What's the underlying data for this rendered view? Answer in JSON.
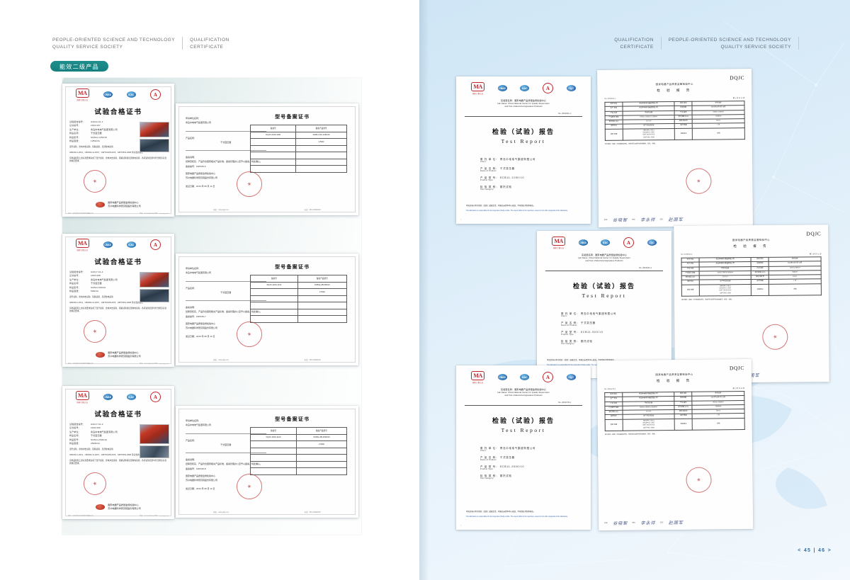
{
  "spread": {
    "page_numbers": "< 45 | 46 >"
  },
  "left_page": {
    "header": {
      "brand_line1": "PEOPLE-ORIENTED SCIENCE AND TECHNOLOGY",
      "brand_line2": "QUALITY SERVICE SOCIETY",
      "section_line1": "QUALIFICATION",
      "section_line2": "CERTIFICATE"
    },
    "badge_label": "能效二级产品"
  },
  "right_page": {
    "header": {
      "section_line1": "QUALIFICATION",
      "section_line2": "CERTIFICATE",
      "brand_line1": "PEOPLE-ORIENTED SCIENCE AND TECHNOLOGY",
      "brand_line2": "QUALITY SERVICE SOCIETY"
    }
  },
  "logos": {
    "cma": "MA",
    "cma_sub": "国家计量认证",
    "cnas": "CNAS",
    "ilac": "ILAC",
    "ccc": "A",
    "ccc_sub": "中国国家强制性产品认证",
    "globe": "CQC"
  },
  "certificates": [
    {
      "title": "试验合格证书",
      "rows": [
        {
          "k": "试验报告编号：",
          "v": "G2022-01-1"
        },
        {
          "k": "证书编号：",
          "v": "2016-067"
        },
        {
          "k": "生产单位：",
          "v": "青岛中电电气集团有限公司"
        },
        {
          "k": "样品名称：",
          "v": "干式变压器"
        },
        {
          "k": "样品型号：",
          "v": "SCB11-1250/10"
        },
        {
          "k": "样品容量：",
          "v": "1250kVA"
        },
        {
          "k": "试验项目：",
          "v": "温升试验、雷电冲击试验、短路试验、局部放电试验"
        },
        {
          "k": "试验依据：",
          "v": "GB1094.1-2013、GB1094.11-2007、GB/T10228-2015、GB/T6451-2008 等标准的规定"
        },
        {
          "k": "试验结论：",
          "v": "该样品按照上述标准要求完成了温升试验、雷电冲击试验、短路试验和局部放电试验，各项试验结果均符合相应标准的规定要求。"
        }
      ],
      "issue_label": "发证日期：",
      "issue_date": "2016 年 08 月 10 日",
      "seal_text": "国家电器产品质量监督检验中心",
      "footer_line1": "国家电器产品质量监督检验中心",
      "footer_line2": "苏州电器科学研究院股份有限公司",
      "micro_left": "地址：江苏省苏州市高新区竹园路28号",
      "micro_right": "电话：0512-68090000   网址：www.jsjky.com"
    },
    {
      "title": "试验合格证书",
      "rows": [
        {
          "k": "试验报告编号：",
          "v": "G2017-01-4"
        },
        {
          "k": "证书编号：",
          "v": "2016-068"
        },
        {
          "k": "生产单位：",
          "v": "青岛中电电气集团有限公司"
        },
        {
          "k": "样品名称：",
          "v": "干式变压器"
        },
        {
          "k": "样品型号：",
          "v": "SCB11-500/10"
        },
        {
          "k": "样品容量：",
          "v": "500kVA"
        },
        {
          "k": "试验项目：",
          "v": "温升试验、雷电冲击试验、短路试验、局部放电试验"
        },
        {
          "k": "试验依据：",
          "v": "GB1094.1-2013、GB1094.11-2007、GB/T10228-2015、GB/T6451-2008 等标准的规定"
        },
        {
          "k": "试验结论：",
          "v": "该样品按照上述标准要求完成了温升试验、雷电冲击试验、短路试验和局部放电试验，各项试验结果均符合相应标准的规定要求。"
        }
      ],
      "issue_label": "发证日期：",
      "issue_date": "2016 年 08 月 10 日",
      "seal_text": "国家电器产品质量监督检验中心",
      "footer_line1": "国家电器产品质量监督检验中心",
      "footer_line2": "苏州电器科学研究院股份有限公司",
      "micro_left": "地址：江苏省苏州市高新区竹园路28号",
      "micro_right": "电话：0512-68090000   网址：www.jsjky.com"
    },
    {
      "title": "试验合格证书",
      "rows": [
        {
          "k": "试验报告编号：",
          "v": "G2017-01-2"
        },
        {
          "k": "证书编号：",
          "v": "2016-069"
        },
        {
          "k": "生产单位：",
          "v": "青岛中电电气集团有限公司"
        },
        {
          "k": "样品名称：",
          "v": "干式变压器"
        },
        {
          "k": "样品型号：",
          "v": "SCB11-2500/10"
        },
        {
          "k": "样品容量：",
          "v": "2500kVA"
        },
        {
          "k": "试验项目：",
          "v": "温升试验、雷电冲击试验、短路试验、局部放电试验"
        },
        {
          "k": "试验依据：",
          "v": "GB1094.1-2013、GB1094.11-2007、GB/T10228-2015、GB/T6451-2008 等标准的规定"
        },
        {
          "k": "试验结论：",
          "v": "该样品按照上述标准要求完成了温升试验、雷电冲击试验、短路试验和局部放电试验，各项试验结果均符合相应标准的规定要求。"
        }
      ],
      "issue_label": "发证日期：",
      "issue_date": "2016 年 08 月 10 日",
      "seal_text": "国家电器产品质量监督检验中心",
      "footer_line1": "国家电器产品质量监督检验中心",
      "footer_line2": "苏州电器科学研究院股份有限公司",
      "micro_left": "地址：江苏省苏州市高新区竹园路28号",
      "micro_right": "电话：0512-68090000   网址：www.jsjky.com"
    }
  ],
  "registrations": [
    {
      "applicant_label": "申请单位名称：",
      "applicant": "青岛中电电气集团有限公司",
      "product_label": "产品名称：",
      "product": "干式变压器",
      "filing_label": "备案说明：",
      "filing_text": "经审查核实，产品符合国家相关产品标准，备案管理办公室予以备案，特此确认。",
      "filing_no_label": "备案编号：",
      "filing_no": "16PKZ9-6",
      "org_line1": "国家电器产品质量监督检验中心",
      "org_line2": "苏州电器科学研究院股份有限公司",
      "date_label": "发证日期：",
      "date": "2016 年 08 月 10 日",
      "table_title": "型号备案证书",
      "table_headers": [
        "备案号",
        "备案产品型号"
      ],
      "table_rows": [
        [
          "DQJC-2016-1100",
          "SCB11-NG-1250/10"
        ],
        [
          "",
          "2.5ΩΩ"
        ],
        [
          "",
          ""
        ],
        [
          "",
          ""
        ],
        [
          "",
          ""
        ],
        [
          "",
          ""
        ],
        [
          "",
          ""
        ]
      ],
      "foot_left": "网址：www.jsjky.com",
      "foot_right": "电话：0512-68090000"
    },
    {
      "applicant_label": "申请单位名称：",
      "applicant": "青岛中电电气集团有限公司",
      "product_label": "产品名称：",
      "product": "干式变压器",
      "filing_label": "备案说明：",
      "filing_text": "经审查核实，产品符合国家相关产品标准，备案管理办公室予以备案，特此确认。",
      "filing_no_label": "备案编号：",
      "filing_no": "16PKZ9-7",
      "org_line1": "国家电器产品质量监督检验中心",
      "org_line2": "苏州电器科学研究院股份有限公司",
      "date_label": "发证日期：",
      "date": "2016 年 08 月 10 日",
      "table_title": "型号备案证书",
      "table_headers": [
        "备案号",
        "备案产品型号"
      ],
      "table_rows": [
        [
          "DQJC-2016-1110",
          "SCB11-ZB-500/10"
        ],
        [
          "",
          "2.5ΩΩ"
        ],
        [
          "",
          ""
        ],
        [
          "",
          ""
        ],
        [
          "",
          ""
        ],
        [
          "",
          ""
        ],
        [
          "",
          ""
        ]
      ],
      "foot_left": "网址：www.jsjky.com",
      "foot_right": "电话：0512-68090000"
    },
    {
      "applicant_label": "申请单位名称：",
      "applicant": "青岛中电电气集团有限公司",
      "product_label": "产品名称：",
      "product": "干式变压器",
      "filing_label": "备案说明：",
      "filing_text": "经审查核实，产品符合国家相关产品标准，备案管理办公室予以备案，特此确认。",
      "filing_no_label": "备案编号：",
      "filing_no": "16PKZ9-8",
      "org_line1": "国家电器产品质量监督检验中心",
      "org_line2": "苏州电器科学研究院股份有限公司",
      "date_label": "发证日期：",
      "date": "2016 年 08 月 10 日",
      "table_title": "型号备案证书",
      "table_headers": [
        "备案号",
        "备案产品型号"
      ],
      "table_rows": [
        [
          "DQJC-2016-1120",
          "SCB11-ZB-2500/10"
        ],
        [
          "",
          "2.5ΩΩ"
        ],
        [
          "",
          ""
        ],
        [
          "",
          ""
        ],
        [
          "",
          ""
        ],
        [
          "",
          ""
        ],
        [
          "",
          ""
        ]
      ],
      "foot_left": "网址：www.jsjky.com",
      "foot_right": "电话：0512-68090000"
    }
  ],
  "test_reports": [
    {
      "lab_label_cn": "实验室名称：",
      "lab_name_cn": "国家电器产品质量监督检验中心",
      "lab_label_en": "Lab Name:",
      "lab_name_en_1": "China National Center for Quality Supervision",
      "lab_name_en_2": "and Test of Electrical Apparatus Products",
      "no": "No. 2016041-1",
      "title_cn": "检验（试验）报告",
      "title_en": "Test  Report",
      "fields": [
        {
          "cn": "委 托 单 位：  青岛中电电气集团有限公司",
          "en": "Client:"
        },
        {
          "cn": "产 品 名 称：  干式变压器",
          "en": "Name of Product:"
        },
        {
          "cn": "产 品 型 号：  SCB11-1250/10",
          "en": "Product Type:"
        },
        {
          "cn": "检 验 类 别：  委托试验",
          "en": "Test Category:"
        }
      ],
      "disclaimer_cn": "本实验室对本次检验（试验）结果负责。本报告未经本中心批准，不得部分复制本报告。",
      "disclaimer_en": "The laboratory is responsible for the inspection (Test) results. The report shall not be reprinted, except in full, with a approval of the laboratory.",
      "page_mark": "①"
    },
    {
      "lab_label_cn": "实验室名称：",
      "lab_name_cn": "国家电器产品质量监督检验中心",
      "lab_label_en": "Lab Name:",
      "lab_name_en_1": "China National Center for Quality Supervision",
      "lab_name_en_2": "and Test of Electrical Apparatus Products",
      "no": "No. 2016041-2",
      "title_cn": "检验（试验）报告",
      "title_en": "Test  Report",
      "fields": [
        {
          "cn": "委 托 单 位：  青岛中电电气集团有限公司",
          "en": "Client:"
        },
        {
          "cn": "产 品 名 称：  干式变压器",
          "en": "Name of Product:"
        },
        {
          "cn": "产 品 型 号：  SCB11-500/10",
          "en": "Product Type:"
        },
        {
          "cn": "检 验 类 别：  委托试验",
          "en": "Test Category:"
        }
      ],
      "disclaimer_cn": "本实验室对本次检验（试验）结果负责。本报告未经本中心批准，不得部分复制本报告。",
      "disclaimer_en": "The laboratory is responsible for the inspection (Test) results. The report shall not be reprinted, except in full, with a approval of the laboratory.",
      "page_mark": "①"
    },
    {
      "lab_label_cn": "实验室名称：",
      "lab_name_cn": "国家电器产品质量监督检验中心",
      "lab_label_en": "Lab Name:",
      "lab_name_en_1": "China National Center for Quality Supervision",
      "lab_name_en_2": "and Test of Electrical Apparatus Products",
      "no": "No. 2016178-1",
      "title_cn": "检验（试验）报告",
      "title_en": "Test  Report",
      "fields": [
        {
          "cn": "委 托 单 位：  青岛中电电气集团有限公司",
          "en": "Client:"
        },
        {
          "cn": "产 品 名 称：  干式变压器",
          "en": "Name of Product:"
        },
        {
          "cn": "产 品 型 号：  SCB11-2500/10",
          "en": "Product Type:"
        },
        {
          "cn": "检 验 类 别：  委托试验",
          "en": "Test Category:"
        }
      ],
      "disclaimer_cn": "本实验室对本次检验（试验）结果负责。本报告未经本中心批准，不得部分复制本报告。",
      "disclaimer_en": "The laboratory is responsible for the inspection (Test) results. The report shall not be reprinted, except in full, with a approval of the laboratory.",
      "page_mark": "①"
    }
  ],
  "data_sheets": [
    {
      "brand": "DQJC",
      "org": "国家电器产品质量监督检验中心",
      "doc_title": "检 验 报 告",
      "no": "No. 2016041-1",
      "date": "第 1 页  共 11 页",
      "rows": [
        {
          "k": "委托\n单位",
          "v": "青岛中电电气集团有限公司",
          "k2": "检验\n类别",
          "v2": "委托试验"
        },
        {
          "k": "生产\n单位",
          "v": "青岛中电电气集团有限公司",
          "k2": "检验日期",
          "v2": "2016年10月7日-10日"
        },
        {
          "k": "产品\n名称",
          "v": "干式变压器",
          "k2": "产品\n编号",
          "v2": "SCB11-1250/10"
        },
        {
          "k": "产品型号\n规格",
          "v": "SCB11-1250/10  1250kVA",
          "k2": "额定容量\n(kVA)",
          "v2": "1250kVA"
        },
        {
          "k": "额定电压\n(kV)",
          "v": "10 / 0.4",
          "k2": "联结\n组标号",
          "v2": "Dyn11"
        },
        {
          "k": "抽样地点",
          "v": "生产单位成品库",
          "k2": "抽样\n数量",
          "v2": "1 台"
        },
        {
          "k": "检验\n依据",
          "v": "GB1094.1-2013\nGB1094.11-2007\nGB/T10228-2015\nGB/T6451-2008",
          "k2": "检验结论",
          "v2": "合格"
        }
      ],
      "note": "本次检验（试验）所列各检验项目，所检项目全部符合标准要求，结论：合格。",
      "sign_labels": [
        "批准：",
        "审核：",
        "主检："
      ],
      "signatures": [
        "谷晓智",
        "李永祥",
        "赵国军"
      ],
      "page_mark": "第 1 页"
    },
    {
      "brand": "DQJC",
      "org": "国家电器产品质量监督检验中心",
      "doc_title": "检 验 报 告",
      "no": "No. 2016041-2",
      "date": "第 1 页  共 11 页",
      "rows": [
        {
          "k": "委托\n单位",
          "v": "青岛中电电气集团有限公司",
          "k2": "检验\n类别",
          "v2": "委托试验"
        },
        {
          "k": "生产\n单位",
          "v": "青岛中电电气集团有限公司",
          "k2": "检验日期",
          "v2": "2016年10月7日-10日"
        },
        {
          "k": "产品\n名称",
          "v": "干式变压器",
          "k2": "产品\n编号",
          "v2": "SCB11-500/10"
        },
        {
          "k": "产品型号\n规格",
          "v": "SCB11-500/10  500kVA",
          "k2": "额定容量\n(kVA)",
          "v2": "500kVA"
        },
        {
          "k": "额定电压\n(kV)",
          "v": "10 / 0.4",
          "k2": "联结\n组标号",
          "v2": "Dyn11"
        },
        {
          "k": "抽样地点",
          "v": "生产单位成品库",
          "k2": "抽样\n数量",
          "v2": "1 台"
        },
        {
          "k": "检验\n依据",
          "v": "GB1094.1-2013\nGB1094.11-2007\nGB/T10228-2015\nGB/T6451-2008",
          "k2": "检验结论",
          "v2": "合格"
        }
      ],
      "note": "本次检验（试验）所列各检验项目，所检项目全部符合标准要求，结论：合格。",
      "sign_labels": [
        "批准：",
        "审核：",
        "主检："
      ],
      "signatures": [
        "谷晓智",
        "李永祥",
        "赵国军"
      ],
      "page_mark": "第 1 页"
    },
    {
      "brand": "DQJC",
      "org": "国家电器产品质量监督检验中心",
      "doc_title": "检 验 报 告",
      "no": "No. 2016178-1",
      "date": "第 1 页  共 11 页",
      "rows": [
        {
          "k": "委托\n单位",
          "v": "青岛中电电气集团有限公司",
          "k2": "检验\n类别",
          "v2": "委托试验"
        },
        {
          "k": "生产\n单位",
          "v": "青岛中电电气集团有限公司",
          "k2": "检验日期",
          "v2": "2016年10月7日-10日"
        },
        {
          "k": "产品\n名称",
          "v": "干式变压器",
          "k2": "产品\n编号",
          "v2": "SCB11-2500/10"
        },
        {
          "k": "产品型号\n规格",
          "v": "SCB11-2500/10  2500kVA",
          "k2": "额定容量\n(kVA)",
          "v2": "2500kVA"
        },
        {
          "k": "额定电压\n(kV)",
          "v": "10 / 0.4",
          "k2": "联结\n组标号",
          "v2": "Dyn11"
        },
        {
          "k": "抽样地点",
          "v": "生产单位成品库",
          "k2": "抽样\n数量",
          "v2": "1 台"
        },
        {
          "k": "检验\n依据",
          "v": "GB1094.1-2013\nGB1094.11-2007\nGB/T10228-2015\nGB/T6451-2008",
          "k2": "检验结论",
          "v2": "合格"
        }
      ],
      "note": "本次检验（试验）所列各检验项目，所检项目全部符合标准要求，结论：合格。",
      "sign_labels": [
        "批准：",
        "审核：",
        "主检："
      ],
      "signatures": [
        "谷晓智",
        "李永祥",
        "赵国军"
      ],
      "page_mark": "第 1 页"
    }
  ]
}
